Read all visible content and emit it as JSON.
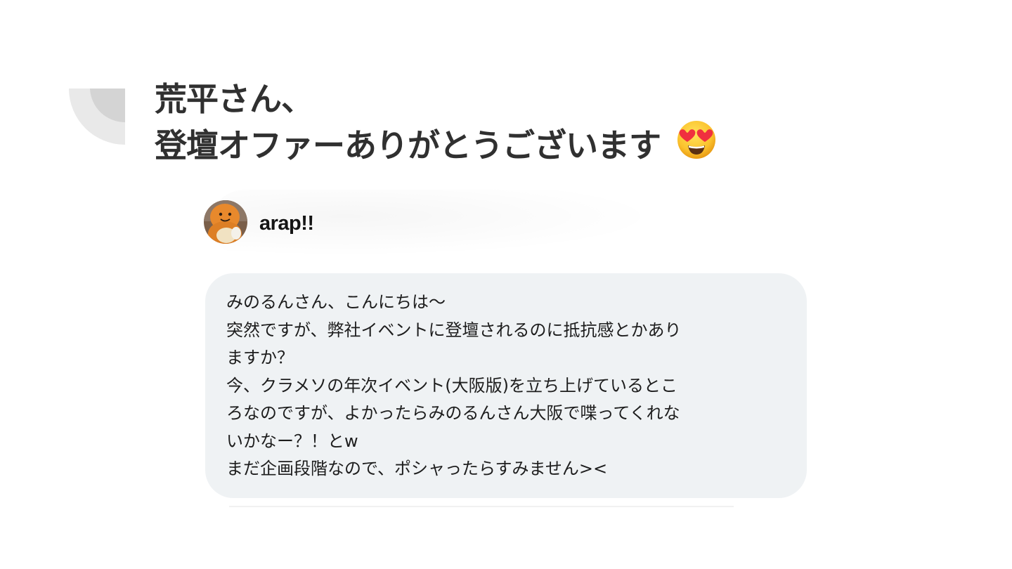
{
  "slide": {
    "title_lines": [
      "荒平さん、",
      "登壇オファーありがとうございます"
    ],
    "title_emoji": "smiling-face-with-heart-eyes"
  },
  "post": {
    "username": "arap!!",
    "avatar_icon": "orange-character-avatar",
    "message_lines": [
      "みのるんさん、こんにちは〜",
      "突然ですが、弊社イベントに登壇されるのに抵抗感とかあり",
      "ますか？",
      "今、クラメソの年次イベント(大阪版)を立ち上げているとこ",
      "ろなのですが、よかったらみのるんさん大阪で喋ってくれな",
      "いかなー？！とw",
      "まだ企画段階なので、ポシャったらすみません><"
    ]
  },
  "colors": {
    "title": "#303030",
    "bubble_bg": "#eff2f4",
    "text": "#1d1d1d",
    "decoration": "#d9d9d9"
  }
}
